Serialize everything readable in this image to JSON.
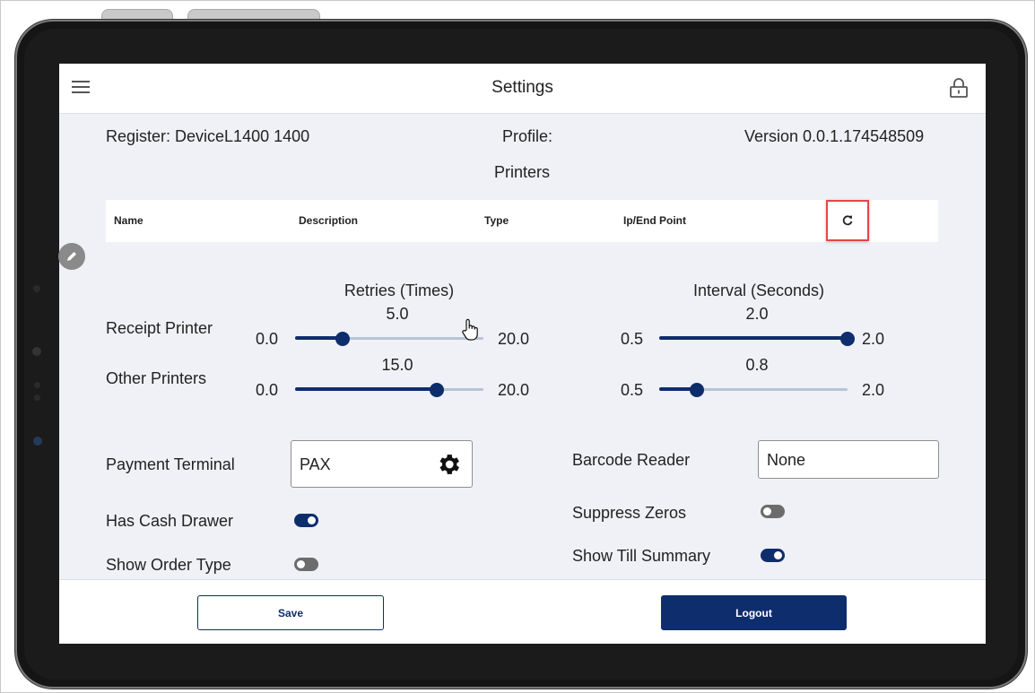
{
  "app": {
    "title": "Settings"
  },
  "header_info": {
    "register": "Register: DeviceL1400 1400",
    "profile": "Profile:",
    "version": "Version 0.0.1.174548509"
  },
  "printers": {
    "section_title": "Printers",
    "columns": [
      "Name",
      "Description",
      "Type",
      "Ip/End Point"
    ]
  },
  "retries": {
    "title": "Retries (Times)",
    "receipt": {
      "value": "5.0",
      "min": "0.0",
      "max": "20.0",
      "fraction": 0.25
    },
    "other": {
      "value": "15.0",
      "min": "0.0",
      "max": "20.0",
      "fraction": 0.75
    }
  },
  "interval": {
    "title": "Interval (Seconds)",
    "receipt": {
      "value": "2.0",
      "min": "0.5",
      "max": "2.0",
      "fraction": 1.0
    },
    "other": {
      "value": "0.8",
      "min": "0.5",
      "max": "2.0",
      "fraction": 0.2
    }
  },
  "labels": {
    "receipt_printer": "Receipt Printer",
    "other_printers": "Other Printers",
    "payment_terminal": "Payment Terminal",
    "barcode_reader": "Barcode Reader",
    "has_cash_drawer": "Has Cash Drawer",
    "suppress_zeros": "Suppress Zeros",
    "show_order_type": "Show Order Type",
    "show_till_summary": "Show Till Summary"
  },
  "values": {
    "payment_terminal": "PAX",
    "barcode_reader": "None"
  },
  "toggles": {
    "has_cash_drawer": true,
    "suppress_zeros": false,
    "show_order_type": false,
    "show_till_summary": true
  },
  "buttons": {
    "save": "Save",
    "logout": "Logout"
  },
  "colors": {
    "primary": "#0e2d6d",
    "highlight": "#e64545",
    "screen_bg": "#eff1f6"
  },
  "icons": [
    "menu-icon",
    "lock-icon",
    "refresh-icon",
    "gear-icon",
    "edit-icon",
    "hand-cursor-icon"
  ]
}
